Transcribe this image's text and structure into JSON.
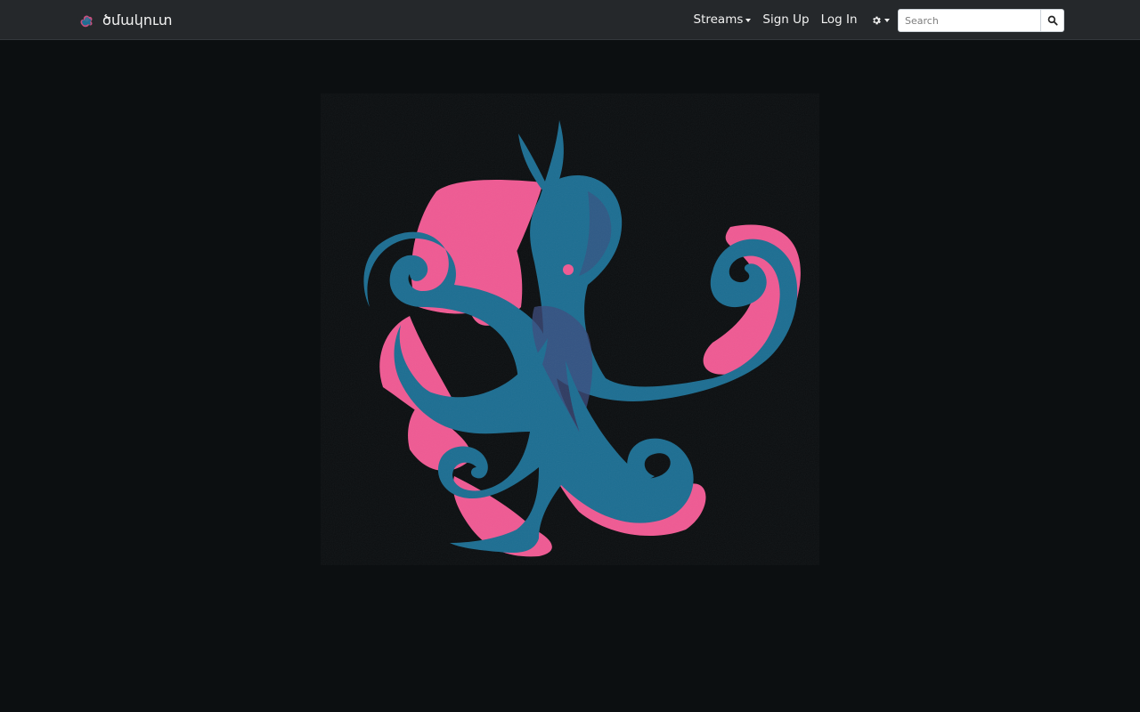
{
  "brand": {
    "name": "ծմակուտ",
    "logo_icon": "octopus-logo-icon"
  },
  "nav": {
    "streams_label": "Streams",
    "signup_label": "Sign Up",
    "login_label": "Log In",
    "settings_icon": "gear-icon"
  },
  "search": {
    "placeholder": "Search",
    "button_icon": "search-icon"
  },
  "hero": {
    "illustration": "octopus-illustration"
  },
  "colors": {
    "navbar": "#25282b",
    "background": "#0c0f11",
    "octopus_blue": "#1d6e92",
    "octopus_pink": "#ef5a93",
    "octopus_purple": "#3c4c7e"
  }
}
